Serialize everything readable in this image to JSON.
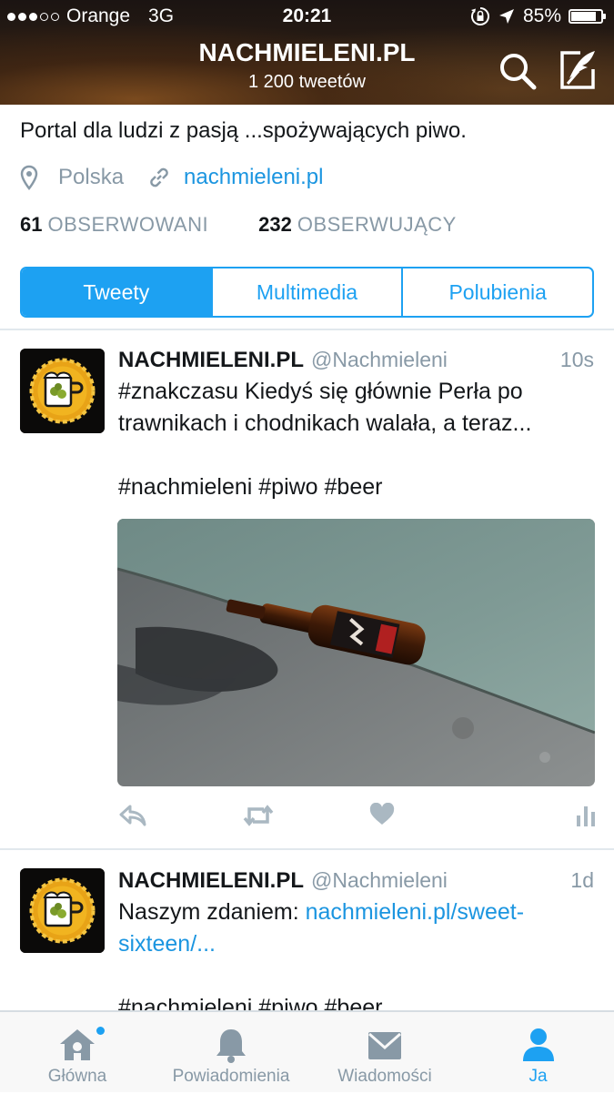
{
  "status_bar": {
    "carrier": "Orange",
    "network": "3G",
    "time": "20:21",
    "battery": "85%",
    "battery_level": 0.85
  },
  "header": {
    "title": "NACHMIELENI.PL",
    "tweet_count": "1 200 tweetów"
  },
  "profile": {
    "bio": "Portal dla ludzi z pasją ...spożywających piwo.",
    "location": "Polska",
    "website": "nachmieleni.pl",
    "following_count": "61",
    "following_label": "OBSERWOWANI",
    "followers_count": "232",
    "followers_label": "OBSERWUJĄCY"
  },
  "tabs": [
    {
      "label": "Tweety",
      "active": true
    },
    {
      "label": "Multimedia",
      "active": false
    },
    {
      "label": "Polubienia",
      "active": false
    }
  ],
  "tweets": [
    {
      "name": "NACHMIELENI.PL",
      "handle": "@Nachmieleni",
      "time": "10s",
      "text_line1": "#znakczasu Kiedyś się głównie Perła po",
      "text_line2": "trawnikach i chodnikach walała, a teraz...",
      "hashtags": "#nachmieleni #piwo #beer"
    },
    {
      "name": "NACHMIELENI.PL",
      "handle": "@Nachmieleni",
      "time": "1d",
      "text_prefix": "Naszym zdaniem: ",
      "link_line1": "nachmieleni.pl/sweet-",
      "link_line2": "sixteen/...",
      "hashtags": "#nachmieleni #piwo #beer"
    }
  ],
  "tab_bar": [
    {
      "label": "Główna",
      "icon": "home-icon"
    },
    {
      "label": "Powiadomienia",
      "icon": "bell-icon"
    },
    {
      "label": "Wiadomości",
      "icon": "envelope-icon"
    },
    {
      "label": "Ja",
      "icon": "person-icon",
      "active": true
    }
  ],
  "colors": {
    "accent": "#1da1f2",
    "link": "#1b95e0",
    "muted": "#8899a6"
  }
}
